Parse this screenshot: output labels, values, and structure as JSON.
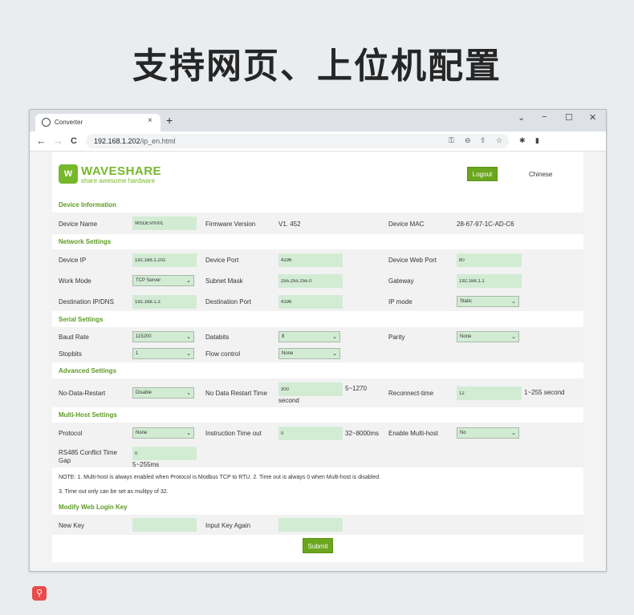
{
  "headline": "支持网页、上位机配置",
  "browser": {
    "tab_title": "Converter",
    "tab_close": "×",
    "new_tab": "+",
    "win_minimize": "−",
    "win_maximize": "☐",
    "win_close": "✕",
    "win_menu": "⌄",
    "url_host": "192.168.1.202",
    "url_path": "/ip_en.html"
  },
  "header": {
    "logo_text": "WAVESHARE",
    "logo_tagline": "share awesome hardware",
    "logo_mark": "W",
    "logout_label": "Logout",
    "language_link": "Chinese"
  },
  "device_info": {
    "title": "Device Information",
    "device_name_label": "Device Name",
    "device_name_value": "WSDEV0001",
    "firmware_label": "Firmware Version",
    "firmware_value": "V1. 452",
    "mac_label": "Device MAC",
    "mac_value": "28-67-97-1C-AD-C6"
  },
  "network": {
    "title": "Network Settings",
    "device_ip_label": "Device IP",
    "device_ip_value": "192.168.1.202",
    "device_port_label": "Device Port",
    "device_port_value": "4196",
    "web_port_label": "Device Web Port",
    "web_port_value": "80",
    "work_mode_label": "Work Mode",
    "work_mode_value": "TCP Server",
    "subnet_label": "Subnet Mask",
    "subnet_value": "255.255.255.0",
    "gateway_label": "Gateway",
    "gateway_value": "192.168.1.1",
    "dest_ip_label": "Destination IP/DNS",
    "dest_ip_value": "192.168.1.3",
    "dest_port_label": "Destination Port",
    "dest_port_value": "4196",
    "ip_mode_label": "IP mode",
    "ip_mode_value": "Static"
  },
  "serial": {
    "title": "Serial Settings",
    "baud_label": "Baud Rate",
    "baud_value": "115200",
    "databits_label": "Databits",
    "databits_value": "8",
    "parity_label": "Parity",
    "parity_value": "None",
    "stopbits_label": "Stopbits",
    "stopbits_value": "1",
    "flow_label": "Flow control",
    "flow_value": "None"
  },
  "advanced": {
    "title": "Advanced Settings",
    "ndr_label": "No-Data-Restart",
    "ndr_value": "Disable",
    "ndr_time_label": "No Data Restart Time",
    "ndr_time_value": "300",
    "ndr_time_unit_a": "5~1270",
    "ndr_time_unit_b": "second",
    "reconnect_label": "Reconnect-time",
    "reconnect_value": "12",
    "reconnect_unit": "1~255 second"
  },
  "multihost": {
    "title": "Multi-Host Settings",
    "protocol_label": "Protocol",
    "protocol_value": "None",
    "timeout_label": "Instruction Time out",
    "timeout_value": "0",
    "timeout_unit": "32~8000ms",
    "enable_label": "Enable Multi-host",
    "enable_value": "No",
    "conflict_label": "RS485 Conflict Time Gap",
    "conflict_value": "0",
    "conflict_unit": "5~255ms",
    "note1": "NOTE: 1. Multi-host is always enabled when Protocol is Modbus TCP to RTU. 2. Time out is always 0 when Multi-host is disabled.",
    "note2": "3. Time out only can be set as mulitpy of 32."
  },
  "login_key": {
    "title": "Modify Web Login Key",
    "new_key_label": "New Key",
    "new_key_value": "",
    "again_label": "Input Key Again",
    "again_value": ""
  },
  "submit_label": "Submit",
  "icons": {
    "globe": "globe-icon",
    "back": "←",
    "forward": "→",
    "reload": "C",
    "key": "⚿",
    "zoom": "⊖",
    "share": "⇪",
    "star": "☆",
    "extension": "✱",
    "sidebar": "▮",
    "search": "⚲"
  },
  "colors": {
    "brand_green": "#76b82a",
    "button_green": "#6aa61e",
    "section_title": "#5c9a24",
    "input_fill": "#d2ecd4",
    "row_band": "#f2f2f2",
    "float_search": "#e94b4b"
  }
}
